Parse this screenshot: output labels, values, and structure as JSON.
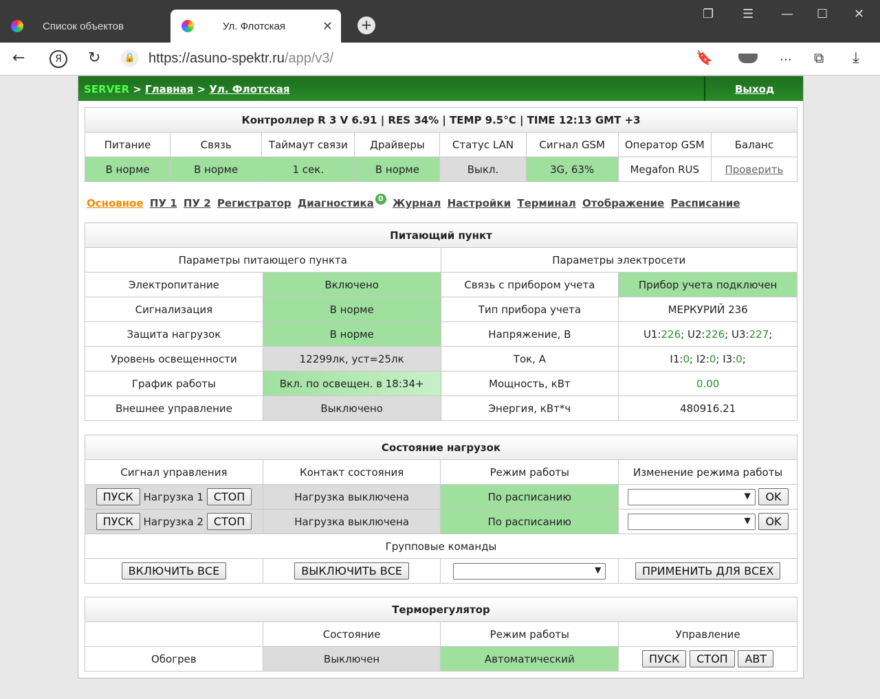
{
  "browser": {
    "tabs": [
      {
        "title": "Список объектов",
        "active": false
      },
      {
        "title": "Ул. Флотская",
        "active": true
      }
    ],
    "url_host": "https://asuno-spektr.ru",
    "url_path": "/app/v3/"
  },
  "header": {
    "server": "SERVER",
    "sep1": " > ",
    "crumb1": "Главная",
    "sep2": " > ",
    "crumb2": "Ул. Флотская",
    "logout": "Выход"
  },
  "controller": {
    "title": "Контроллер R 3 V 6.91 | RES 34% | TEMP 9.5°C | TIME 12:13 GMT +3",
    "columns": [
      "Питание",
      "Связь",
      "Таймаут связи",
      "Драйверы",
      "Статус LAN",
      "Сигнал GSM",
      "Оператор GSM",
      "Баланс"
    ],
    "values": [
      "В норме",
      "В норме",
      "1 сек.",
      "В норме",
      "Выкл.",
      "3G, 63%",
      "Megafon RUS",
      "Проверить"
    ]
  },
  "menu": {
    "items": [
      "Основное",
      "ПУ 1",
      "ПУ 2",
      "Регистратор",
      "Диагностика",
      "Журнал",
      "Настройки",
      "Терминал",
      "Отображение",
      "Расписание"
    ],
    "diag_badge": "0"
  },
  "feed": {
    "title": "Питающий пункт",
    "left_header": "Параметры питающего пункта",
    "right_header": "Параметры электросети",
    "rows": [
      {
        "l_label": "Электропитание",
        "l_value": "Включено",
        "r_label": "Связь с прибором учета",
        "r_value": "Прибор учета подключен"
      },
      {
        "l_label": "Сигнализация",
        "l_value": "В норме",
        "r_label": "Тип прибора учета",
        "r_value": "МЕРКУРИЙ 236"
      },
      {
        "l_label": "Защита нагрузок",
        "l_value": "В норме",
        "r_label": "Напряжение, В",
        "r_value": ""
      },
      {
        "l_label": "Уровень освещенности",
        "l_value": "12299лк, уст=25лк",
        "r_label": "Ток, А",
        "r_value": ""
      },
      {
        "l_label": "График работы",
        "l_value": "Вкл. по освещен. в 18:34+",
        "r_label": "Мощность, кВт",
        "r_value": "0.00"
      },
      {
        "l_label": "Внешнее управление",
        "l_value": "Выключено",
        "r_label": "Энергия, кВт*ч",
        "r_value": "480916.21"
      }
    ],
    "voltage": {
      "u1": "U1:",
      "v1": "226",
      "u2": "; U2:",
      "v2": "226",
      "u3": "; U3:",
      "v3": "227",
      "end": ";"
    },
    "current": {
      "i1": "I1:",
      "v1": "0",
      "i2": "; I2:",
      "v2": "0",
      "i3": "; I3:",
      "v3": "0",
      "end": ";"
    }
  },
  "loads": {
    "title": "Состояние нагрузок",
    "headers": [
      "Сигнал управления",
      "Контакт состояния",
      "Режим работы",
      "Изменение режима работы"
    ],
    "rows": [
      {
        "start": "ПУСК",
        "name": "Нагрузка 1",
        "stop": "СТОП",
        "contact": "Нагрузка выключена",
        "mode": "По расписанию",
        "ok": "OK"
      },
      {
        "start": "ПУСК",
        "name": "Нагрузка 2",
        "stop": "СТОП",
        "contact": "Нагрузка выключена",
        "mode": "По расписанию",
        "ok": "OK"
      }
    ],
    "group_title": "Групповые команды",
    "all_on": "ВКЛЮЧИТЬ ВСЕ",
    "all_off": "ВЫКЛЮЧИТЬ ВСЕ",
    "apply_all": "ПРИМЕНИТЬ ДЛЯ ВСЕХ"
  },
  "thermo": {
    "title": "Терморегулятор",
    "headers": [
      "",
      "Состояние",
      "Режим работы",
      "Управление"
    ],
    "name": "Обогрев",
    "state": "Выключен",
    "mode": "Автоматический",
    "btn_start": "ПУСК",
    "btn_stop": "СТОП",
    "btn_auto": "АВТ"
  }
}
